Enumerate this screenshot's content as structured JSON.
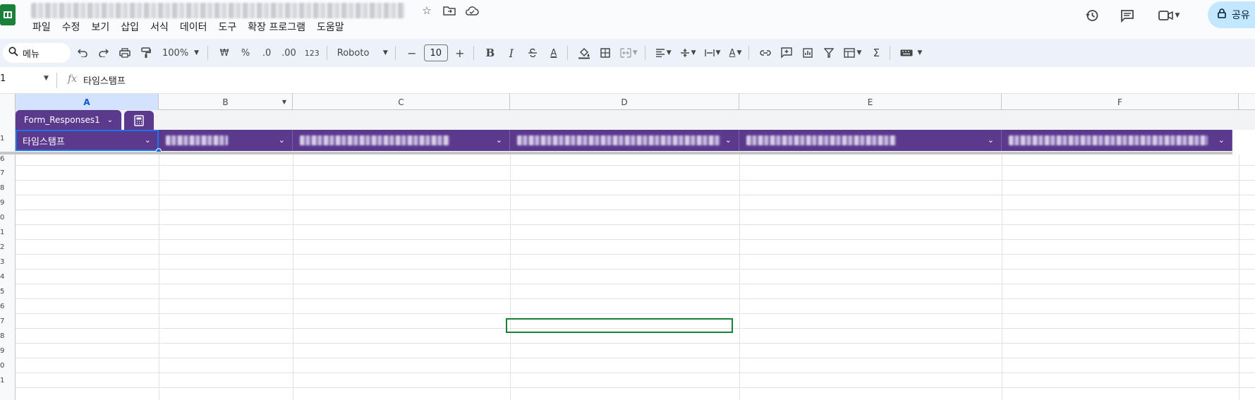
{
  "app": {
    "logo": "sheets-logo-icon"
  },
  "title_icons": [
    "star-icon",
    "move-to-folder-icon",
    "cloud-saved-icon"
  ],
  "menu": [
    "파일",
    "수정",
    "보기",
    "삽입",
    "서식",
    "데이터",
    "도구",
    "확장 프로그램",
    "도움말"
  ],
  "header_right": {
    "share_label": "공유",
    "icons": [
      "history-icon",
      "comments-icon",
      "meet-icon",
      "lock-icon"
    ]
  },
  "toolbar": {
    "search_label": "메뉴",
    "zoom": "100%",
    "currency": "₩",
    "percent": "%",
    "dec_decrease": ".0",
    "dec_increase": ".00",
    "number_format": "123",
    "font": "Roboto",
    "font_size": "10",
    "minus": "−",
    "plus": "+",
    "bold": "B",
    "italic": "I",
    "text_color": "A",
    "sigma": "Σ"
  },
  "formula_bar": {
    "cell_ref": "1",
    "fx": "fx",
    "content": "타임스탬프"
  },
  "columns": [
    "A",
    "B",
    "C",
    "D",
    "E",
    "F"
  ],
  "table": {
    "name": "Form_Responses1",
    "first_header": "타임스탬프"
  },
  "row_numbers": [
    "1",
    "6",
    "7",
    "8",
    "9",
    "0",
    "1",
    "2",
    "3",
    "4",
    "5",
    "6",
    "7",
    "8",
    "9",
    "0",
    "1"
  ]
}
